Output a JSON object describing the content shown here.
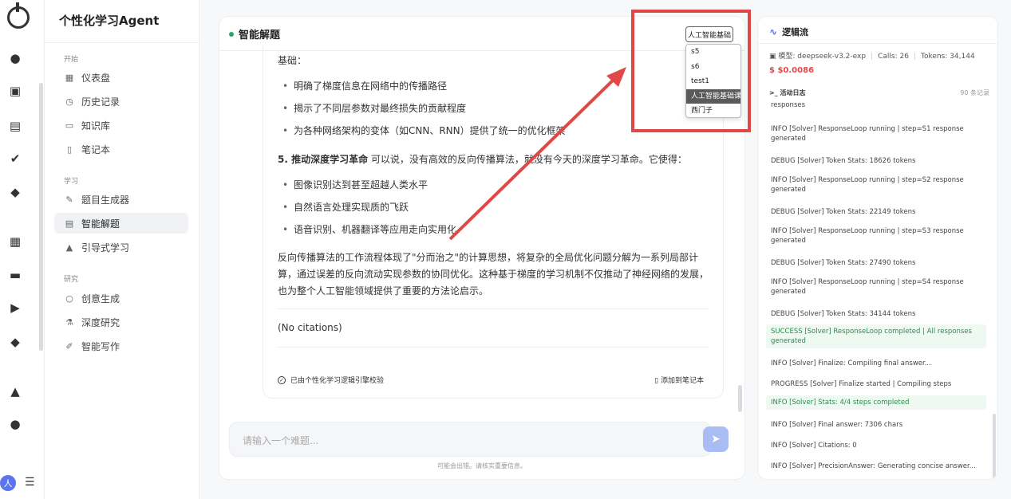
{
  "sidebar": {
    "app_title": "个性化学习Agent",
    "sections": [
      {
        "label": "开始",
        "items": [
          {
            "label": "仪表盘",
            "icon": "dashboard-icon"
          },
          {
            "label": "历史记录",
            "icon": "history-icon"
          },
          {
            "label": "知识库",
            "icon": "book-icon"
          },
          {
            "label": "笔记本",
            "icon": "notebook-icon"
          }
        ]
      },
      {
        "label": "学习",
        "items": [
          {
            "label": "题目生成器",
            "icon": "pen-icon"
          },
          {
            "label": "智能解题",
            "icon": "calculator-icon",
            "active": true
          },
          {
            "label": "引导式学习",
            "icon": "graduation-cap-icon"
          }
        ]
      },
      {
        "label": "研究",
        "items": [
          {
            "label": "创意生成",
            "icon": "lightbulb-icon"
          },
          {
            "label": "深度研究",
            "icon": "flask-icon"
          },
          {
            "label": "智能写作",
            "icon": "pencil-icon"
          }
        ]
      }
    ],
    "avatar_initial": "人"
  },
  "main": {
    "title": "智能解题",
    "model_button": "人工智能基础",
    "dropdown_options": [
      "s5",
      "s6",
      "test1",
      "人工智能基础课",
      "西门子"
    ],
    "selected_option": "人工智能基础课",
    "content": {
      "intro_line": "基础：",
      "bullets_1": [
        "明确了梯度信息在网络中的传播路径",
        "揭示了不同层参数对最终损失的贡献程度",
        "为各种网络架构的变体（如CNN、RNN）提供了统一的优化框架"
      ],
      "point5_title": "5. 推动深度学习革命",
      "point5_text": "可以说，没有高效的反向传播算法，就没有今天的深度学习革命。它使得：",
      "bullets_2": [
        "图像识别达到甚至超越人类水平",
        "自然语言处理实现质的飞跃",
        "语音识别、机器翻译等应用走向实用化"
      ],
      "summary": "反向传播算法的工作流程体现了\"分而治之\"的计算思想，将复杂的全局优化问题分解为一系列局部计算，通过误差的反向流动实现参数的协同优化。这种基于梯度的学习机制不仅推动了神经网络的发展，也为整个人工智能领域提供了重要的方法论启示。",
      "citations": "(No citations)"
    },
    "verified_label": "已由个性化学习逻辑引擎校验",
    "add_notebook_label": "添加到笔记本",
    "input_placeholder": "请输入一个难题...",
    "disclaimer": "可能会出错。请核实重要信息。"
  },
  "panel": {
    "title": "逻辑流",
    "model_label": "模型: deepseek-v3.2-exp",
    "calls": "Calls: 26",
    "tokens": "Tokens: 34,144",
    "cost": "$0.0086",
    "log_title": "活动日志",
    "log_count": "90 条记录",
    "logs": [
      {
        "text": "responses",
        "ok": false
      },
      {
        "text": "INFO [Solver] ResponseLoop running | step=S1 response generated",
        "ok": false
      },
      {
        "text": "DEBUG [Solver] Token Stats: 18626 tokens",
        "ok": false
      },
      {
        "text": "INFO [Solver] ResponseLoop running | step=S2 response generated",
        "ok": false
      },
      {
        "text": "DEBUG [Solver] Token Stats: 22149 tokens",
        "ok": false
      },
      {
        "text": "INFO [Solver] ResponseLoop running | step=S3 response generated",
        "ok": false
      },
      {
        "text": "DEBUG [Solver] Token Stats: 27490 tokens",
        "ok": false
      },
      {
        "text": "INFO [Solver] ResponseLoop running | step=S4 response generated",
        "ok": false
      },
      {
        "text": "DEBUG [Solver] Token Stats: 34144 tokens",
        "ok": false
      },
      {
        "text": "SUCCESS [Solver] ResponseLoop completed | All responses generated",
        "ok": true
      },
      {
        "text": "INFO [Solver] Finalize: Compiling final answer...",
        "ok": false
      },
      {
        "text": "PROGRESS [Solver] Finalize started | Compiling steps",
        "ok": false
      },
      {
        "text": "INFO [Solver] Stats: 4/4 steps completed",
        "ok": true
      },
      {
        "text": "INFO [Solver] Final answer: 7306 chars",
        "ok": false
      },
      {
        "text": "INFO [Solver] Citations: 0",
        "ok": false
      },
      {
        "text": "INFO [Solver] PrecisionAnswer: Generating concise answer...",
        "ok": false
      }
    ]
  },
  "colors": {
    "accent": "#4a6cf7",
    "annotation": "#e04848",
    "success_bg": "#eefaf1",
    "active_dot": "#2fa36b"
  }
}
